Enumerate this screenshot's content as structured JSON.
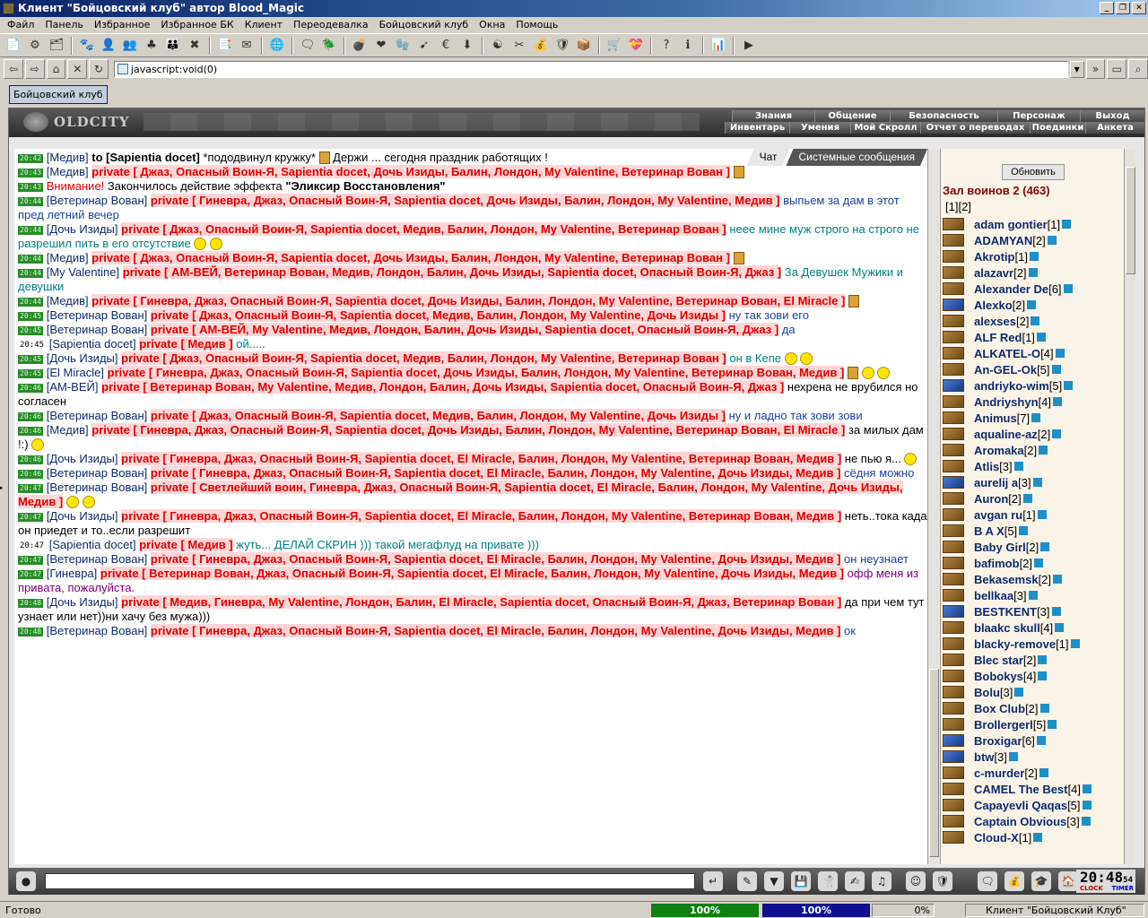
{
  "window": {
    "title": "Клиент \"Бойцовский клуб\" автор Blood_Magic",
    "buttons": [
      "_",
      "❐",
      "✕"
    ]
  },
  "menu": [
    "Файл",
    "Панель",
    "Избранное",
    "Избранное БК",
    "Клиент",
    "Переодевалка",
    "Бойцовский клуб",
    "Окна",
    "Помощь"
  ],
  "toolbar_icons": [
    "📄",
    "⚙",
    "🗂",
    "|",
    "🐾",
    "👤",
    "👥",
    "♣",
    "👪",
    "✖",
    "|",
    "📑",
    "✉",
    "|",
    "🌐",
    "|",
    "🗨",
    "🪲",
    "|",
    "💣",
    "❤",
    "🧤",
    "➹",
    "€",
    "⬇",
    "|",
    "☯",
    "✂",
    "💰",
    "🛡",
    "📦",
    "|",
    "🛒",
    "💝",
    "|",
    "?",
    "ℹ",
    "|",
    "📊",
    "|",
    "▶"
  ],
  "address": {
    "value": "javascript:void(0)"
  },
  "tab": {
    "label": "Бойцовский клуб"
  },
  "game": {
    "logo": "OLDCITY",
    "nav_top": [
      "Знания",
      "Общение",
      "Безопасность",
      "Персонаж",
      "Выход"
    ],
    "nav_bottom": [
      "Инвентарь",
      "Умения",
      "Мой Скролл",
      "Отчет о переводах",
      "Поединки",
      "Анкета"
    ],
    "chat_tabs": [
      "Чат",
      "Системные сообщения"
    ]
  },
  "messages": [
    {
      "t": "20:42",
      "a": "[Медив]",
      "to": "to [Sapientia docet]",
      "txt": "*пододвинул кружку* ",
      "beer": true,
      "txt2": " Держи ... сегодня праздник работящих !"
    },
    {
      "t": "20:43",
      "a": "[Медив]",
      "priv": "private [ Джаз, Опасный Воин-Я, Sapientia docet, Дочь Изиды, Балин, Лондон, My Valentine, Ветеринар Вован ]",
      "beer": true
    },
    {
      "t": "20:43",
      "warn": "Внимание!",
      "txt": " Закончилось действие эффекта ",
      "bold": "\"Эликсир Восстановления\""
    },
    {
      "t": "20:44",
      "a": "[Ветеринар Вован]",
      "priv": "private [ Гиневра, Джаз, Опасный Воин-Я, Sapientia docet, Дочь Изиды, Балин, Лондон, My Valentine, Медив ]",
      "txt": " выпьем за дам в этот пред летний вечер",
      "tc": "blue"
    },
    {
      "t": "20:44",
      "a": "[Дочь Изиды]",
      "priv": "private [ Джаз, Опасный Воин-Я, Sapientia docet, Медив, Балин, Лондон, My Valentine, Ветеринар Вован ]",
      "smiles": 2,
      "txt": " неее мине муж строго на строго не разрешил пить в его отсутствие",
      "tc": "teal"
    },
    {
      "t": "20:44",
      "a": "[Медив]",
      "priv": "private [ Джаз, Опасный Воин-Я, Sapientia docet, Дочь Изиды, Балин, Лондон, My Valentine, Ветеринар Вован ]",
      "beer": true
    },
    {
      "t": "20:44",
      "a": "[My Valentine]",
      "priv": "private [ АМ-ВЕЙ, Ветеринар Вован, Медив, Лондон, Балин, Дочь Изиды, Sapientia docet, Опасный Воин-Я, Джаз ]",
      "txt": " За Девушек Мужики и девушки",
      "tc": "teal"
    },
    {
      "t": "20:44",
      "a": "[Медив]",
      "priv": "private [ Гиневра, Джаз, Опасный Воин-Я, Sapientia docet, Дочь Изиды, Балин, Лондон, My Valentine, Ветеринар Вован, El Miracle ]",
      "beer": true
    },
    {
      "t": "20:45",
      "a": "[Ветеринар Вован]",
      "priv": "private [ Джаз, Опасный Воин-Я, Sapientia docet, Медив, Балин, Лондон, My Valentine, Дочь Изиды ]",
      "txt": " ну так зови его",
      "tc": "blue"
    },
    {
      "t": "20:45",
      "a": "[Ветеринар Вован]",
      "priv": "private [ АМ-ВЕЙ, My Valentine, Медив, Лондон, Балин, Дочь Изиды, Sapientia docet, Опасный Воин-Я, Джаз ]",
      "txt": " да",
      "tc": "blue"
    },
    {
      "t": "20:45",
      "plain": true,
      "a": "[Sapientia docet]",
      "priv": "private [ Медив ]",
      "txt": " ой.....",
      "tc": "teal"
    },
    {
      "t": "20:45",
      "a": "[Дочь Изиды]",
      "priv": "private [ Джаз, Опасный Воин-Я, Sapientia docet, Медив, Балин, Лондон, My Valentine, Ветеринар Вован ]",
      "txt": " он в Кепе ",
      "tc": "teal",
      "smiles": 2
    },
    {
      "t": "20:45",
      "a": "[El Miracle]",
      "priv": "private [ Гиневра, Джаз, Опасный Воин-Я, Sapientia docet, Дочь Изиды, Балин, Лондон, My Valentine, Ветеринар Вован, Медив ]",
      "beer": true,
      "smiles": 2
    },
    {
      "t": "20:46",
      "a": "[АМ-ВЕЙ]",
      "priv": "private [ Ветеринар Вован, My Valentine, Медив, Лондон, Балин, Дочь Изиды, Sapientia docet, Опасный Воин-Я, Джаз ]",
      "txt": " нехрена не врубился но согласен",
      "tc": ""
    },
    {
      "t": "20:46",
      "a": "[Ветеринар Вован]",
      "priv": "private [ Джаз, Опасный Воин-Я, Sapientia docet, Медив, Балин, Лондон, My Valentine, Дочь Изиды ]",
      "txt": " ну и ладно так зови зови",
      "tc": "blue"
    },
    {
      "t": "20:46",
      "a": "[Медив]",
      "priv": "private [ Гиневра, Джаз, Опасный Воин-Я, Sapientia docet, Дочь Изиды, Балин, Лондон, My Valentine, Ветеринар Вован, El Miracle ]",
      "smiles": 1,
      "txt": " за милых дам !:)",
      "tc": ""
    },
    {
      "t": "20:46",
      "a": "[Дочь Изиды]",
      "priv": "private [ Гиневра, Джаз, Опасный Воин-Я, Sapientia docet, El Miracle, Балин, Лондон, My Valentine, Ветеринар Вован, Медив ]",
      "txt": " не пью я...",
      "tc": "",
      "smiles": 1
    },
    {
      "t": "20:46",
      "a": "[Ветеринар Вован]",
      "priv": "private [ Гиневра, Джаз, Опасный Воин-Я, Sapientia docet, El Miracle, Балин, Лондон, My Valentine, Дочь Изиды, Медив ]",
      "txt": " сёдня можно",
      "tc": "blue"
    },
    {
      "t": "20:47",
      "a": "[Ветеринар Вован]",
      "priv": "private [ Светлейший воин, Гиневра, Джаз, Опасный Воин-Я, Sapientia docet, El Miracle, Балин, Лондон, My Valentine, Дочь Изиды, Медив ]",
      "smiles": 2
    },
    {
      "t": "20:47",
      "a": "[Дочь Изиды]",
      "priv": "private [ Гиневра, Джаз, Опасный Воин-Я, Sapientia docet, El Miracle, Балин, Лондон, My Valentine, Ветеринар Вован, Медив ]",
      "txt": "неть..тока када он приедет и то..если разрешит",
      "tc": ""
    },
    {
      "t": "20:47",
      "plain": true,
      "a": "[Sapientia docet]",
      "priv": "private [ Медив ]",
      "txt": " жуть... ДЕЛАЙ СКРИН ))) такой мегафлуд на привате )))",
      "tc": "teal"
    },
    {
      "t": "20:47",
      "a": "[Ветеринар Вован]",
      "priv": "private [ Гиневра, Джаз, Опасный Воин-Я, Sapientia docet, El Miracle, Балин, Лондон, My Valentine, Дочь Изиды, Медив ]",
      "txt": " он неузнает",
      "tc": "blue"
    },
    {
      "t": "20:47",
      "a": "[Гиневра]",
      "priv": "private [ Ветеринар Вован, Джаз, Опасный Воин-Я, Sapientia docet, El Miracle, Балин, Лондон, My Valentine, Дочь Изиды, Медив ]",
      "txt": " офф меня из привата, пожалуйста.",
      "tc": "purple"
    },
    {
      "t": "20:48",
      "a": "[Дочь Изиды]",
      "priv": "private [ Медив, Гиневра, My Valentine, Лондон, Балин, El Miracle, Sapientia docet, Опасный Воин-Я, Джаз, Ветеринар Вован ]",
      "txt": " да при чем тут узнает или нет))ни хачу без мужа)))",
      "tc": ""
    },
    {
      "t": "20:48",
      "a": "[Ветеринар Вован]",
      "priv": "private [ Гиневра, Джаз, Опасный Воин-Я, Sapientia docet, El Miracle, Балин, Лондон, My Valentine, Дочь Изиды, Медив ]",
      "txt": " ок",
      "tc": "blue"
    }
  ],
  "sidebar": {
    "refresh": "Обновить",
    "room": "Зал воинов 2 (463)",
    "pages": "[1][2]",
    "users": [
      {
        "n": "adam gontier",
        "l": "[1]"
      },
      {
        "n": "ADAMYAN",
        "l": "[2]"
      },
      {
        "n": "Akrotip",
        "l": "[1]"
      },
      {
        "n": "alazavr",
        "l": "[2]"
      },
      {
        "n": "Alexander De",
        "l": "[6]"
      },
      {
        "n": "Alexko",
        "l": "[2]",
        "alt": true
      },
      {
        "n": "alexses",
        "l": "[2]"
      },
      {
        "n": "ALF Red",
        "l": "[1]"
      },
      {
        "n": "ALKATEL-O",
        "l": "[4]"
      },
      {
        "n": "An-GEL-Ok",
        "l": "[5]"
      },
      {
        "n": "andriyko-wim",
        "l": "[5]",
        "alt": true
      },
      {
        "n": "Andriyshyn",
        "l": "[4]"
      },
      {
        "n": "Animus",
        "l": "[7]"
      },
      {
        "n": "aqualine-az",
        "l": "[2]"
      },
      {
        "n": "Aromaka",
        "l": "[2]"
      },
      {
        "n": "Atlis",
        "l": "[3]"
      },
      {
        "n": "aurelij a",
        "l": "[3]",
        "alt": true
      },
      {
        "n": "Auron",
        "l": "[2]"
      },
      {
        "n": "avgan ru",
        "l": "[1]"
      },
      {
        "n": "B A X",
        "l": "[5]"
      },
      {
        "n": "Baby Girl",
        "l": "[2]"
      },
      {
        "n": "bafimob",
        "l": "[2]"
      },
      {
        "n": "Bekasemsk",
        "l": "[2]"
      },
      {
        "n": "bellkaa",
        "l": "[3]"
      },
      {
        "n": "BESTKENT",
        "l": "[3]",
        "alt": true
      },
      {
        "n": "blaakc skull",
        "l": "[4]"
      },
      {
        "n": "blacky-remove",
        "l": "[1]"
      },
      {
        "n": "Blec star",
        "l": "[2]"
      },
      {
        "n": "Bobokys",
        "l": "[4]"
      },
      {
        "n": "Bolu",
        "l": "[3]"
      },
      {
        "n": "Box Club",
        "l": "[2]"
      },
      {
        "n": "Brollergerl",
        "l": "[5]"
      },
      {
        "n": "Broxigar",
        "l": "[6]",
        "alt": true
      },
      {
        "n": "btw",
        "l": "[3]",
        "alt": true
      },
      {
        "n": "c-murder",
        "l": "[2]"
      },
      {
        "n": "CAMEL The Best",
        "l": "[4]"
      },
      {
        "n": "Capayevli Qaqas",
        "l": "[5]"
      },
      {
        "n": "Captain Obvious",
        "l": "[3]"
      },
      {
        "n": "Cloud-X",
        "l": "[1]"
      }
    ]
  },
  "bottom_icons": [
    "↵",
    "✎",
    "▼",
    "💾",
    "🤺",
    "✍",
    "♫",
    "☺",
    "🛡",
    "🗨",
    "💰",
    "🎓",
    "🏠",
    "EXIT"
  ],
  "clock": {
    "time": "20:48",
    "sec": "54",
    "clock_label": "CLOCK",
    "timer_label": "TIMER"
  },
  "status": {
    "text": "Готово",
    "prog1": "100%",
    "prog2": "100%",
    "prog3": "0%",
    "right": "Клиент \"Бойцовский Клуб\""
  },
  "colors": {
    "private": "#e00000",
    "timestamp_bg": "#2b8b2b",
    "user": "#102a6b",
    "title_start": "#0a246a"
  }
}
